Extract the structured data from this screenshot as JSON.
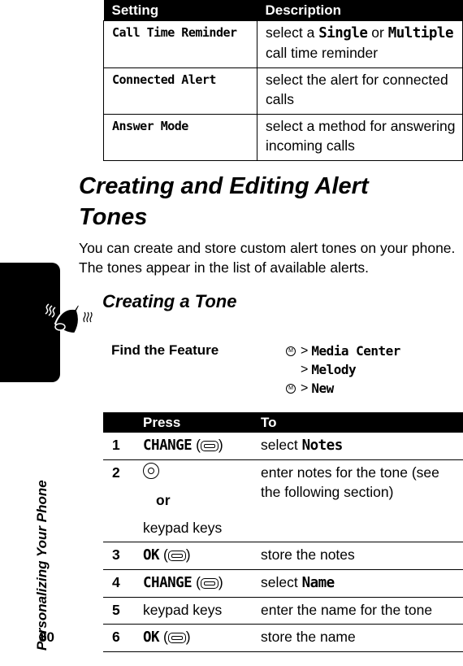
{
  "settings_table": {
    "headers": [
      "Setting",
      "Description"
    ],
    "rows": [
      {
        "setting": "Call Time Reminder",
        "desc_pre": "select a ",
        "opt1": "Single",
        "desc_mid": " or ",
        "opt2": "Multiple",
        "desc_post": " call time reminder"
      },
      {
        "setting": "Connected Alert",
        "description": "select the alert for connected calls"
      },
      {
        "setting": "Answer Mode",
        "description": "select a method for answering incoming calls"
      }
    ]
  },
  "heading": "Creating and Editing Alert Tones",
  "intro": "You can create and store custom alert tones on your phone. The tones appear in the list of available alerts.",
  "subheading": "Creating a Tone",
  "side_title": "Personalizing Your Phone",
  "page_number": "80",
  "icons": {
    "chapter": "alert-bell-icon",
    "menu": "menu-key-icon",
    "soft_key": "soft-key-icon",
    "nav": "nav-key-icon"
  },
  "find_feature": {
    "label": "Find the Feature",
    "gt": ">",
    "menu_glyph": "M",
    "path": [
      "Media Center",
      "Melody",
      "New"
    ]
  },
  "steps_table": {
    "headers": [
      "Press",
      "To"
    ],
    "rows": [
      {
        "num": "1",
        "press": "CHANGE",
        "to_pre": "select ",
        "to_bold": "Notes"
      },
      {
        "num": "2",
        "press_or": "or",
        "press_alt": "keypad keys",
        "to": "enter notes for the tone (see the following section)"
      },
      {
        "num": "3",
        "press": "OK",
        "to": "store the notes"
      },
      {
        "num": "4",
        "press": "CHANGE",
        "to_pre": "select ",
        "to_bold": "Name"
      },
      {
        "num": "5",
        "press_text": "keypad keys",
        "to": "enter the name for the tone"
      },
      {
        "num": "6",
        "press": "OK",
        "to": "store the name"
      }
    ]
  }
}
